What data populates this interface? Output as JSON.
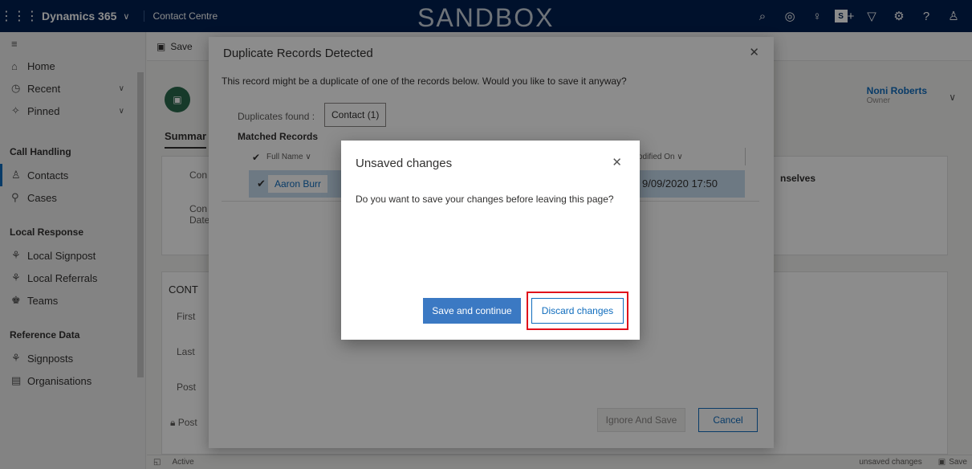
{
  "topbar": {
    "app_name": "Dynamics 365",
    "area_name": "Contact Centre",
    "environment_label": "SANDBOX",
    "badge": "S"
  },
  "sidebar": {
    "top_items": [
      {
        "label": "Home"
      },
      {
        "label": "Recent"
      },
      {
        "label": "Pinned"
      }
    ],
    "sections": [
      {
        "title": "Call Handling",
        "items": [
          {
            "label": "Contacts"
          },
          {
            "label": "Cases"
          }
        ]
      },
      {
        "title": "Local Response",
        "items": [
          {
            "label": "Local Signpost"
          },
          {
            "label": "Local Referrals"
          },
          {
            "label": "Teams"
          }
        ]
      },
      {
        "title": "Reference Data",
        "items": [
          {
            "label": "Signposts"
          },
          {
            "label": "Organisations"
          }
        ]
      }
    ]
  },
  "command_bar": {
    "save_label": "Save"
  },
  "record": {
    "tab_label": "Summar",
    "owner_name": "Noni Roberts",
    "owner_role": "Owner",
    "field_fragment_1": "Con",
    "field_fragment_2": "Con",
    "field_fragment_3": "Date",
    "side_text": "nselves",
    "section_label": "CONT",
    "first_label": "First",
    "last_label": "Last",
    "post_label": "Post",
    "post2_label": "Post"
  },
  "status_bar": {
    "status": "Active",
    "unsaved_text": "unsaved changes",
    "save_label": "Save"
  },
  "duplicate_dialog": {
    "title": "Duplicate Records Detected",
    "message": "This record might be a duplicate of one of the records below. Would you like to save it anyway?",
    "found_label": "Duplicates found :",
    "found_value": "Contact (1)",
    "matched_label": "Matched Records",
    "columns": [
      "Full Name",
      "odified On"
    ],
    "rows": [
      {
        "full_name": "Aaron Burr",
        "modified_on": "9/09/2020 17:50"
      }
    ],
    "ignore_label": "Ignore And Save",
    "cancel_label": "Cancel"
  },
  "unsaved_dialog": {
    "title": "Unsaved changes",
    "message": "Do you want to save your changes before leaving this page?",
    "save_label": "Save and continue",
    "discard_label": "Discard changes"
  },
  "colors": {
    "nav": "#002050",
    "accent": "#0f6cbd",
    "primary_button": "#3b79c3",
    "highlight": "#e0101b",
    "row_selected": "#c7dcef"
  }
}
